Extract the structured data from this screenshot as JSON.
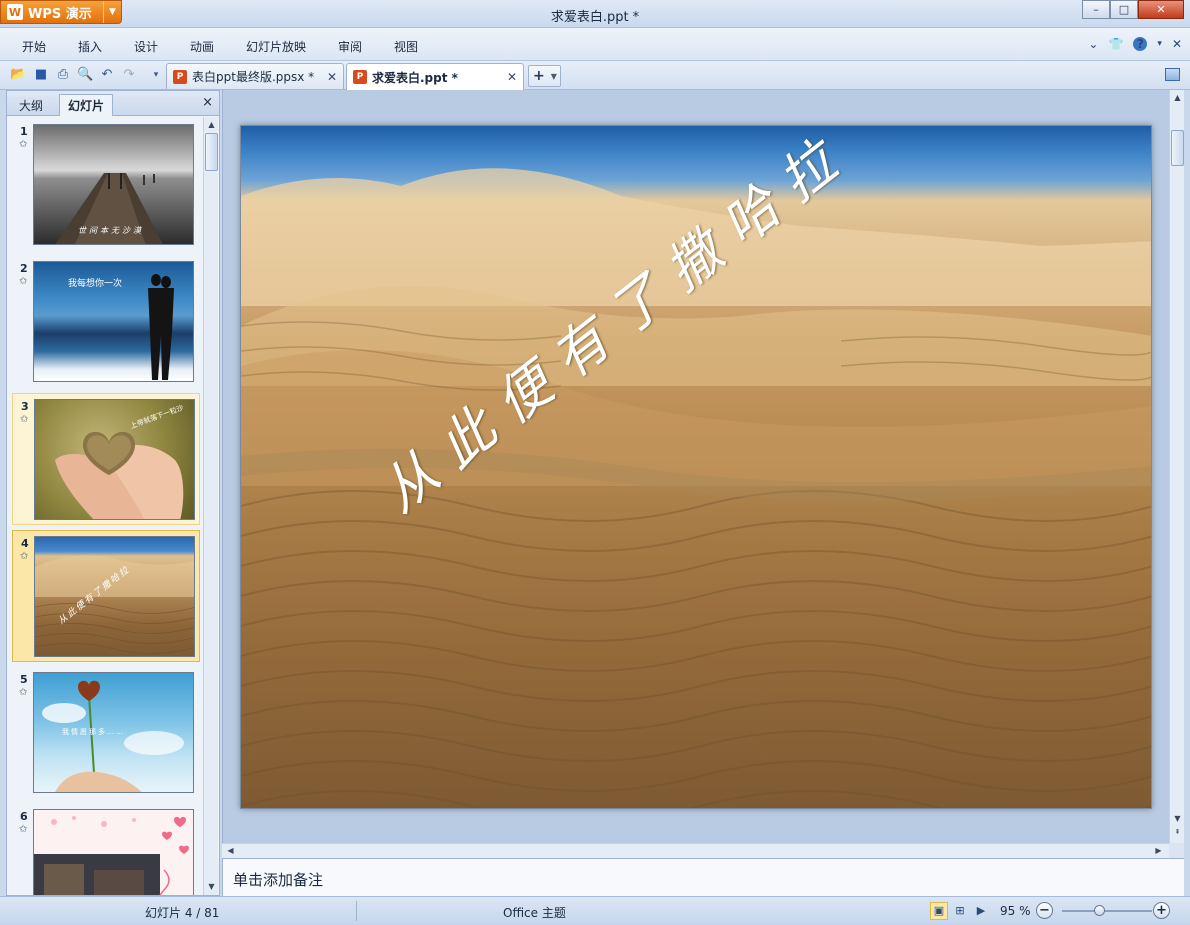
{
  "app": {
    "button_label": "WPS 演示",
    "logo_glyph": "W",
    "window_title": "求爱表白.ppt *",
    "accent_color": "#e2700c"
  },
  "menu": {
    "items": [
      "开始",
      "插入",
      "设计",
      "动画",
      "幻灯片放映",
      "审阅",
      "视图"
    ]
  },
  "tabs": [
    {
      "label": "表白ppt最终版.ppsx *",
      "active": false
    },
    {
      "label": "求爱表白.ppt *",
      "active": true
    }
  ],
  "panel": {
    "tabs": [
      "大纲",
      "幻灯片"
    ],
    "active_tab": "幻灯片",
    "close_glyph": "×",
    "slides": [
      {
        "num": "1",
        "star": "✩",
        "caption": "世间本无沙漠"
      },
      {
        "num": "2",
        "star": "✩",
        "caption": "我每想你一次"
      },
      {
        "num": "3",
        "star": "✩",
        "caption": "上帝就落下一粒沙"
      },
      {
        "num": "4",
        "star": "✩",
        "caption": "从此便有了撒哈拉"
      },
      {
        "num": "5",
        "star": "✩",
        "caption": "我情愿那多……"
      },
      {
        "num": "6",
        "star": "✩",
        "caption": ""
      }
    ],
    "selected_slide": 4
  },
  "slide": {
    "text": "从此便有了撒哈拉"
  },
  "notes": {
    "placeholder": "单击添加备注"
  },
  "status": {
    "slide_counter": "幻灯片 4 / 81",
    "theme": "Office 主题",
    "zoom": "95 %",
    "zoom_percent": 95
  }
}
